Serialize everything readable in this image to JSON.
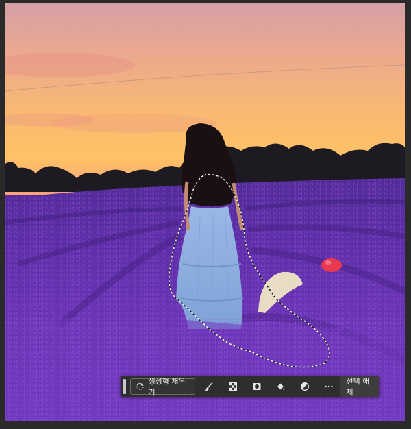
{
  "canvas": {
    "image_subject": "woman-in-lavender-field-at-sunset",
    "selection": "marching-ants-lasso"
  },
  "taskbar": {
    "generative_fill_label": "생성형 채우기",
    "tools": [
      {
        "icon": "brush-icon",
        "name": "modify-selection-brush"
      },
      {
        "icon": "checker-icon",
        "name": "transparency-selection"
      },
      {
        "icon": "mask-icon",
        "name": "create-mask"
      },
      {
        "icon": "paint-bucket-icon",
        "name": "fill-selection"
      },
      {
        "icon": "adjustment-icon",
        "name": "adjustment-layer"
      },
      {
        "icon": "more-icon",
        "name": "more-options"
      }
    ],
    "deselect_label": "선택 해제"
  },
  "colors": {
    "sky_top": "#e7a08c",
    "sky_horizon": "#ffc56a",
    "lavender": "#6a33b8",
    "dress": "#8fb1e0",
    "taskbar_bg": "#2e2e2e"
  }
}
